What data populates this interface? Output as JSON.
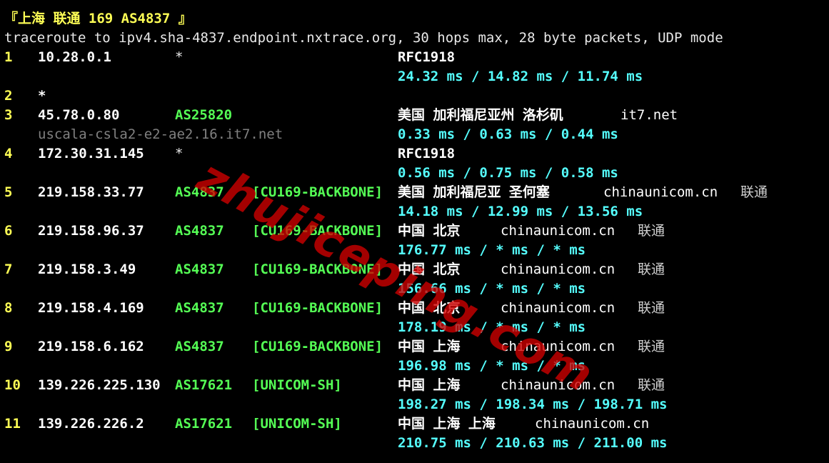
{
  "title": "『上海 联通 169 AS4837 』",
  "header": "traceroute to ipv4.sha-4837.endpoint.nxtrace.org, 30 hops max, 28 byte packets, UDP mode",
  "hops": [
    {
      "num": "1",
      "ip": "10.28.0.1",
      "asn": "*",
      "tag": "",
      "geo": "RFC1918",
      "org": "",
      "isp": "",
      "rdns": "",
      "rtt": "24.32 ms / 14.82 ms / 11.74 ms"
    },
    {
      "num": "2",
      "ip": "*",
      "asn": "",
      "tag": "",
      "geo": "",
      "org": "",
      "isp": "",
      "rdns": "",
      "rtt": ""
    },
    {
      "num": "3",
      "ip": "45.78.0.80",
      "asn": "AS25820",
      "tag": "",
      "geo": "美国 加利福尼亚州 洛杉矶",
      "org": "it7.net",
      "isp": "",
      "rdns": "uscala-csla2-e2-ae2.16.it7.net",
      "rtt": "0.33 ms / 0.63 ms / 0.44 ms"
    },
    {
      "num": "4",
      "ip": "172.30.31.145",
      "asn": "*",
      "tag": "",
      "geo": "RFC1918",
      "org": "",
      "isp": "",
      "rdns": "",
      "rtt": "0.56 ms / 0.75 ms / 0.58 ms"
    },
    {
      "num": "5",
      "ip": "219.158.33.77",
      "asn": "AS4837",
      "tag": "[CU169-BACKBONE]",
      "geo": "美国 加利福尼亚 圣何塞",
      "org": "chinaunicom.cn",
      "isp": "联通",
      "rdns": "",
      "rtt": "14.18 ms / 12.99 ms / 13.56 ms"
    },
    {
      "num": "6",
      "ip": "219.158.96.37",
      "asn": "AS4837",
      "tag": "[CU169-BACKBONE]",
      "geo": "中国 北京",
      "org": "chinaunicom.cn",
      "isp": "联通",
      "rdns": "",
      "rtt": "176.77 ms / * ms / * ms"
    },
    {
      "num": "7",
      "ip": "219.158.3.49",
      "asn": "AS4837",
      "tag": "[CU169-BACKBONE]",
      "geo": "中国 北京",
      "org": "chinaunicom.cn",
      "isp": "联通",
      "rdns": "",
      "rtt": "156.66 ms / * ms / * ms"
    },
    {
      "num": "8",
      "ip": "219.158.4.169",
      "asn": "AS4837",
      "tag": "[CU169-BACKBONE]",
      "geo": "中国 北京",
      "org": "chinaunicom.cn",
      "isp": "联通",
      "rdns": "",
      "rtt": "178.19 ms / * ms / * ms"
    },
    {
      "num": "9",
      "ip": "219.158.6.162",
      "asn": "AS4837",
      "tag": "[CU169-BACKBONE]",
      "geo": "中国 上海",
      "org": "chinaunicom.cn",
      "isp": "联通",
      "rdns": "",
      "rtt": "196.98 ms / * ms / * ms"
    },
    {
      "num": "10",
      "ip": "139.226.225.130",
      "asn": "AS17621",
      "tag": "[UNICOM-SH]",
      "geo": "中国 上海",
      "org": "chinaunicom.cn",
      "isp": "联通",
      "rdns": "",
      "rtt": "198.27 ms / 198.34 ms / 198.71 ms"
    },
    {
      "num": "11",
      "ip": "139.226.226.2",
      "asn": "AS17621",
      "tag": "[UNICOM-SH]",
      "geo": "中国 上海 上海",
      "org": "chinaunicom.cn",
      "isp": "",
      "rdns": "",
      "rtt": "210.75 ms / 210.63 ms / 211.00 ms"
    }
  ],
  "watermark": "zhujiceping.com",
  "colors": {
    "background": "#000000",
    "hop_number": "#ffff55",
    "asn": "#55ff55",
    "rtt": "#55ffff",
    "rdns": "#808080",
    "watermark": "#d20000"
  }
}
